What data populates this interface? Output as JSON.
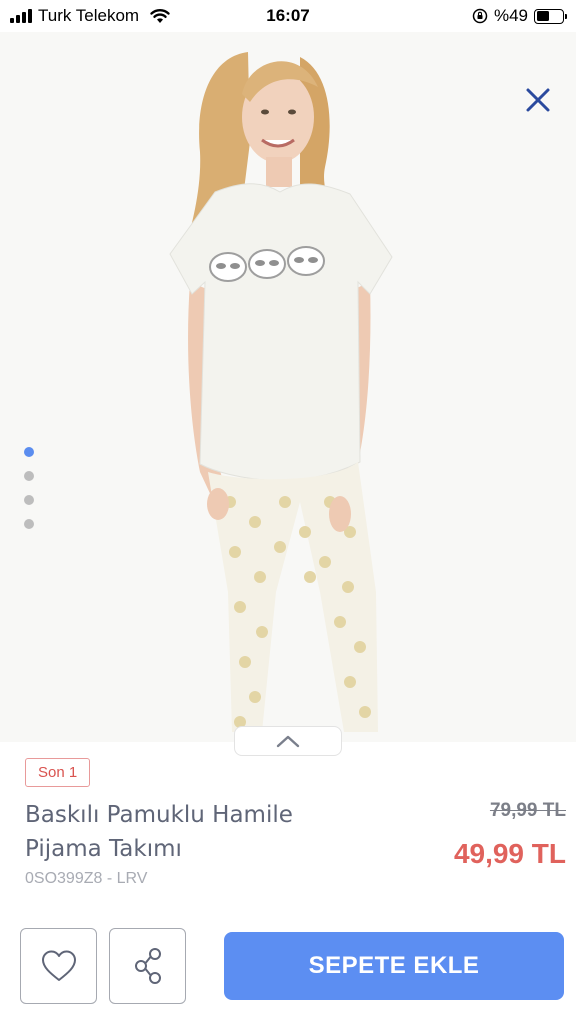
{
  "status_bar": {
    "carrier": "Turk Telekom",
    "time": "16:07",
    "battery_text": "%49",
    "battery_level": 0.49
  },
  "gallery": {
    "image_count": 4,
    "active_index": 0,
    "image_description_icon": "product-photo"
  },
  "product": {
    "stock_badge": "Son 1",
    "title": "Baskılı Pamuklu Hamile Pijama Takımı",
    "code": "0SO399Z8 - LRV",
    "old_price": "79,99 TL",
    "new_price": "49,99 TL"
  },
  "actions": {
    "add_to_cart": "SEPETE EKLE",
    "favorite_icon": "heart-icon",
    "share_icon": "share-icon",
    "close_icon": "close-icon",
    "expand_icon": "chevron-up-icon"
  },
  "colors": {
    "accent_blue": "#5c8ef2",
    "price_red": "#e0625c",
    "close_blue": "#2b4a9e"
  }
}
